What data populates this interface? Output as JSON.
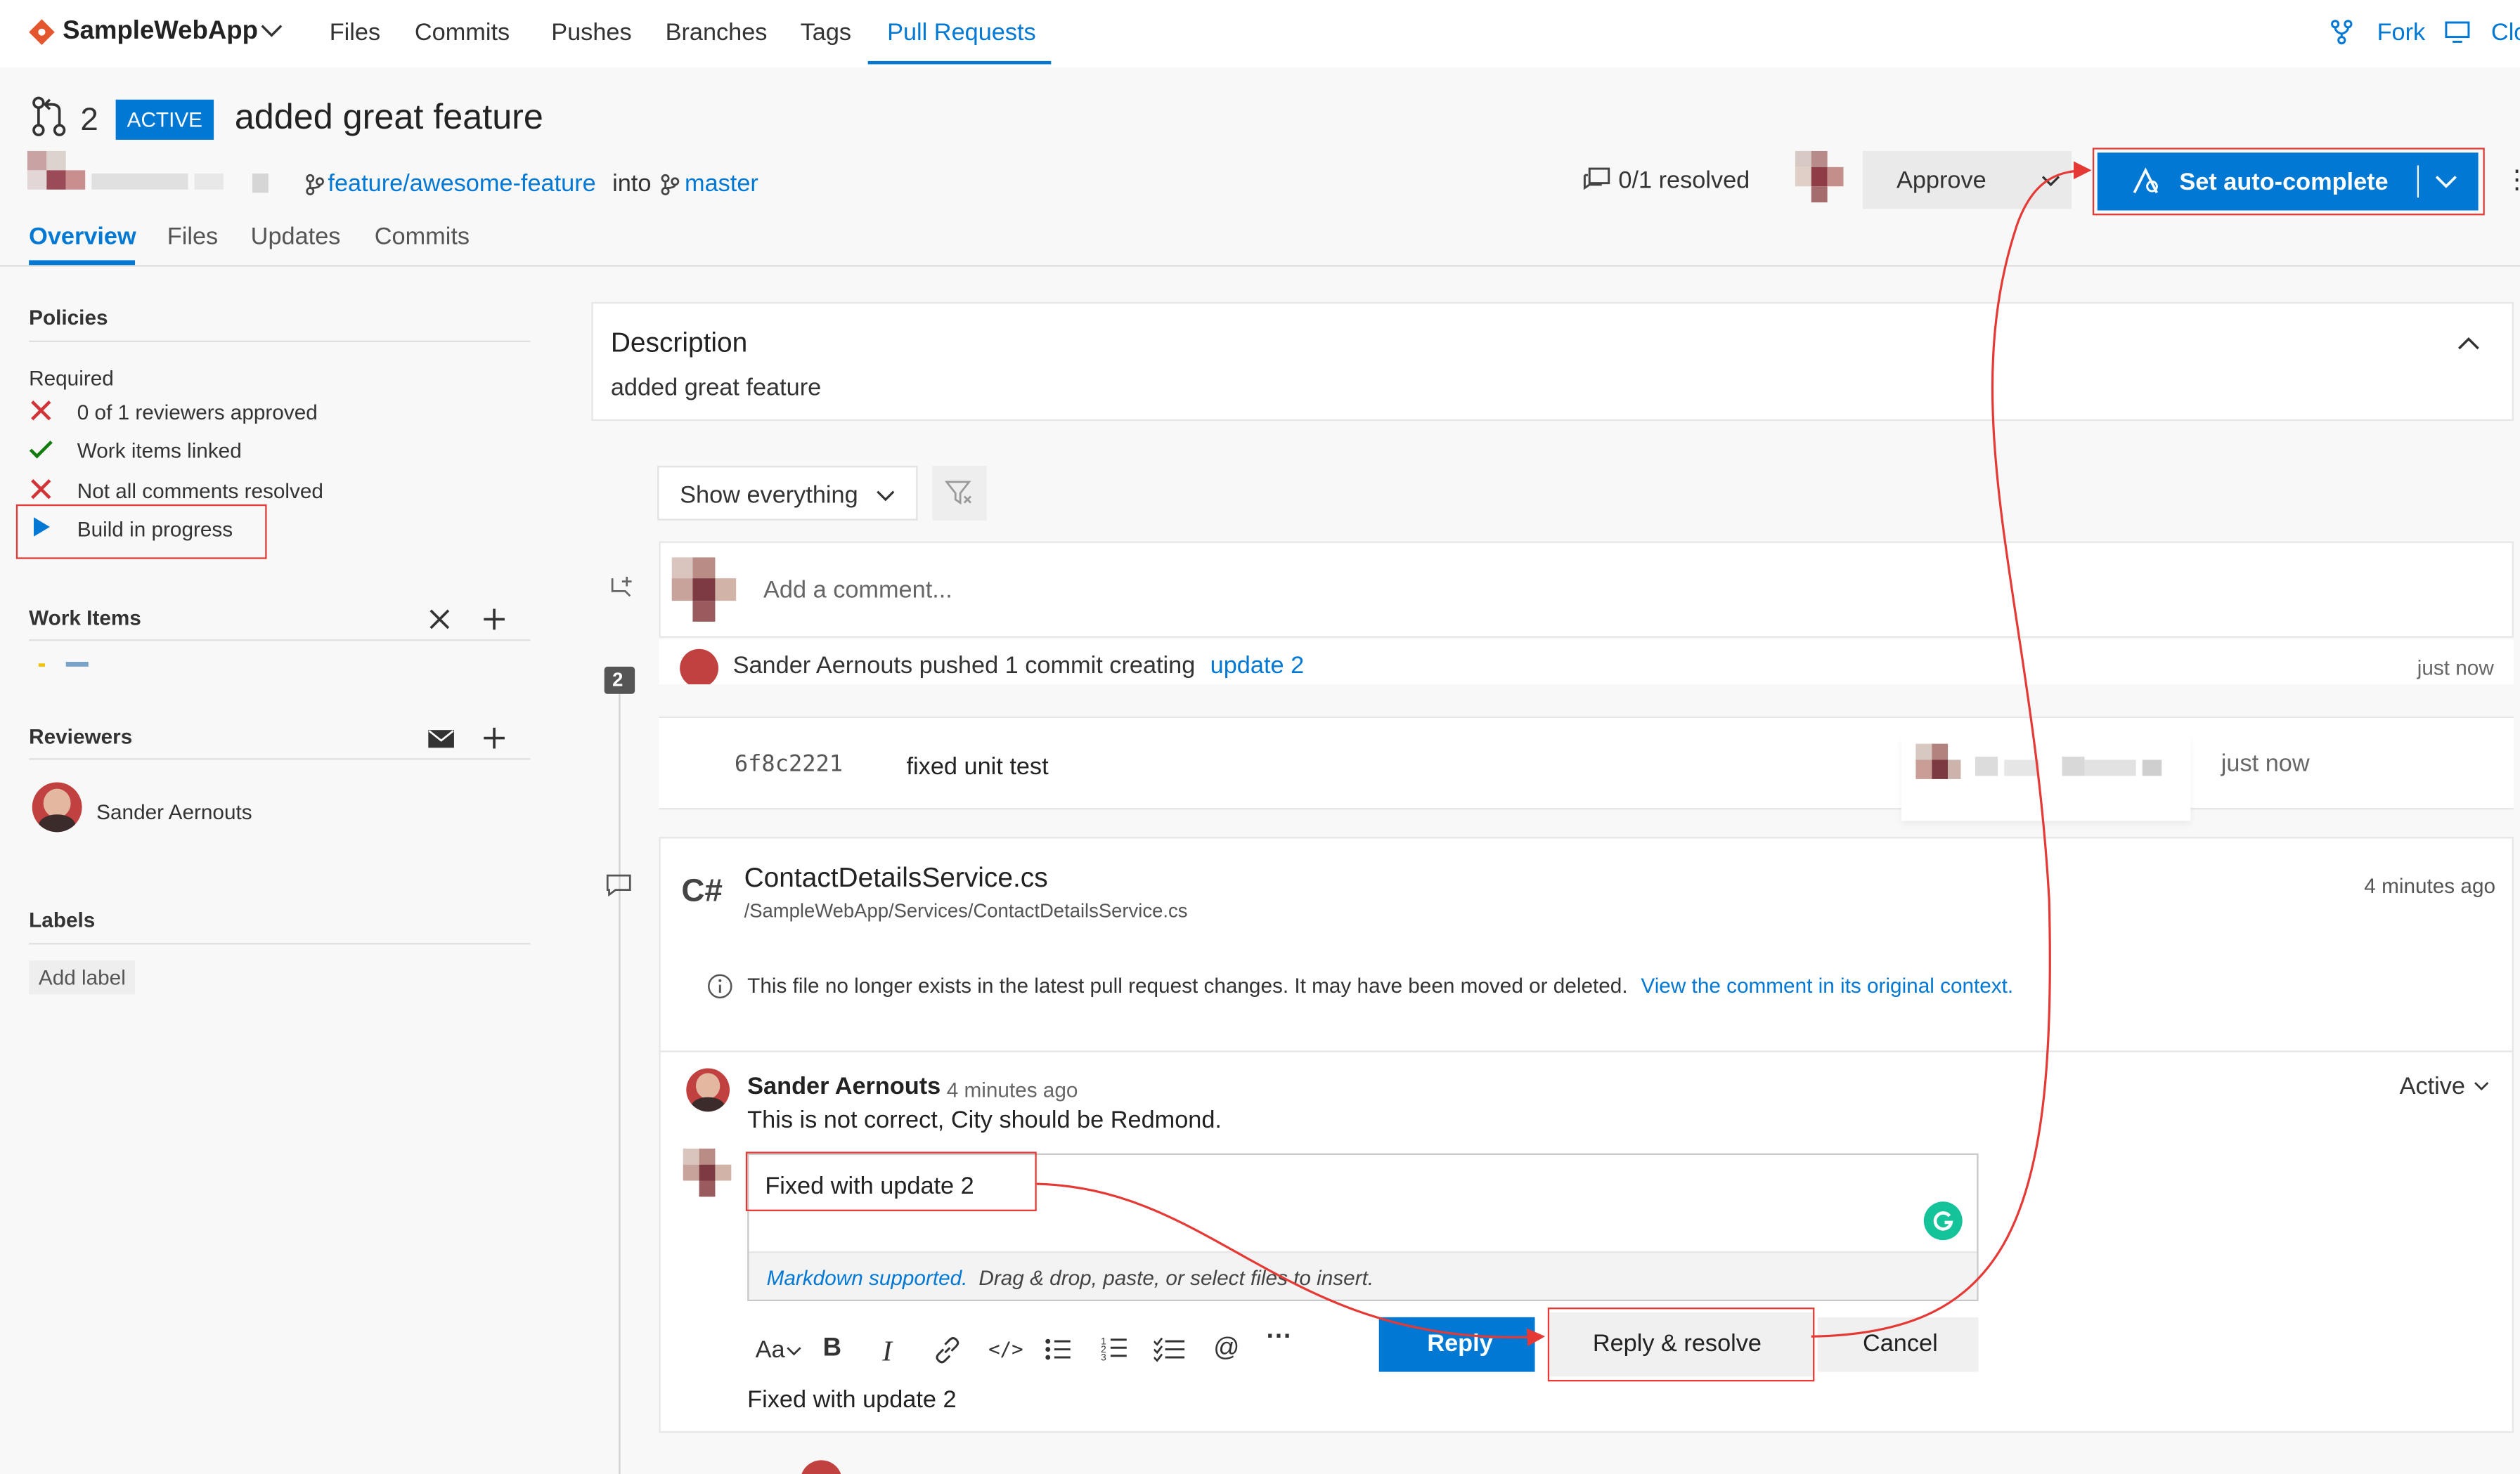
{
  "topnav": {
    "repo_name": "SampleWebApp",
    "tabs": [
      "Files",
      "Commits",
      "Pushes",
      "Branches",
      "Tags",
      "Pull Requests"
    ],
    "fork_label": "Fork",
    "clone_label": "Clo"
  },
  "pr": {
    "number": "2",
    "status": "ACTIVE",
    "title": "added great feature",
    "source_branch": "feature/awesome-feature",
    "into": "into",
    "target_branch": "master",
    "resolved": "0/1 resolved",
    "approve_label": "Approve",
    "autocomplete_label": "Set auto-complete",
    "more": "⋮",
    "tabs": [
      "Overview",
      "Files",
      "Updates",
      "Commits"
    ]
  },
  "sidebar": {
    "policies_heading": "Policies",
    "required_label": "Required",
    "policies": [
      {
        "label": "0 of 1 reviewers approved",
        "state": "fail"
      },
      {
        "label": "Work items linked",
        "state": "pass"
      },
      {
        "label": "Not all comments resolved",
        "state": "fail"
      },
      {
        "label": "Build in progress",
        "state": "running"
      }
    ],
    "work_items_heading": "Work Items",
    "reviewers_heading": "Reviewers",
    "reviewer_name": "Sander Aernouts",
    "labels_heading": "Labels",
    "add_label": "Add label"
  },
  "description": {
    "heading": "Description",
    "text": "added great feature"
  },
  "filter": {
    "selected": "Show everything"
  },
  "comment_box": {
    "placeholder": "Add a comment..."
  },
  "push_event": {
    "number": "2",
    "text": "Sander Aernouts pushed 1 commit creating",
    "link": "update 2",
    "time": "just now",
    "commit_hash": "6f8c2221",
    "commit_message": "fixed unit test",
    "commit_time": "just now"
  },
  "file_thread": {
    "lang": "C#",
    "file_name": "ContactDetailsService.cs",
    "file_path": "/SampleWebApp/Services/ContactDetailsService.cs",
    "time": "4 minutes ago",
    "notice": "This file no longer exists in the latest pull request changes. It may have been moved or deleted.",
    "notice_link": "View the comment in its original context."
  },
  "comment": {
    "author": "Sander Aernouts",
    "time": "4 minutes ago",
    "text": "This is not correct, City should be Redmond.",
    "status": "Active"
  },
  "reply": {
    "text": "Fixed with update 2",
    "markdown_link": "Markdown supported.",
    "markdown_hint": "Drag & drop, paste, or select files to insert.",
    "toolbar": [
      "Aa",
      "B",
      "I",
      "link",
      "</>",
      "bullets",
      "numbers",
      "tasks",
      "@",
      "···"
    ],
    "reply_label": "Reply",
    "reply_resolve_label": "Reply & resolve",
    "cancel_label": "Cancel",
    "preview": "Fixed with update 2"
  },
  "colors": {
    "accent": "#0078d4",
    "fail": "#d13438",
    "pass": "#107c10",
    "annotation": "#e53935"
  }
}
